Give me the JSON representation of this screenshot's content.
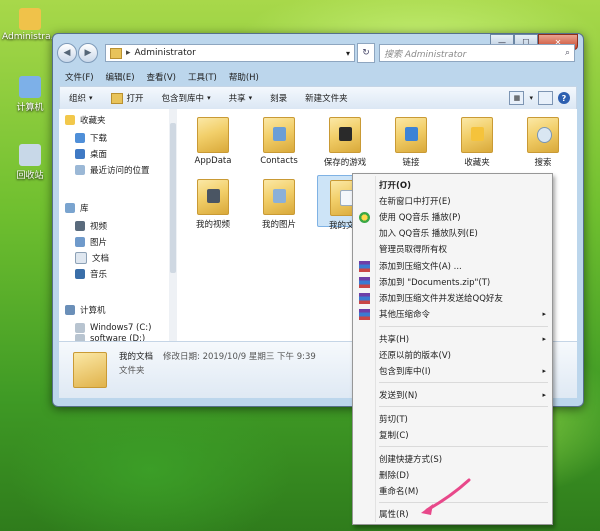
{
  "desktop": {
    "icons": [
      {
        "label": "Administra...",
        "color": "#f0c24a"
      },
      {
        "label": "计算机",
        "color": "#7db0e8"
      },
      {
        "label": "回收站",
        "color": "#c8d8e8"
      }
    ]
  },
  "window": {
    "controls": {
      "minimize": "—",
      "maximize": "☐",
      "close": "✕"
    },
    "nav": {
      "back": "◀",
      "forward": "▶"
    },
    "address": {
      "separator": "▸",
      "path": "Administrator",
      "dropdown": "▾"
    },
    "refresh": "↻",
    "search": {
      "placeholder": "搜索 Administrator",
      "icon": "⌕"
    },
    "menu": [
      "文件(F)",
      "编辑(E)",
      "查看(V)",
      "工具(T)",
      "帮助(H)"
    ],
    "toolbar": {
      "organize": "组织",
      "open": "打开",
      "include_library": "包含到库中",
      "share": "共享",
      "burn": "刻录",
      "new_folder": "新建文件夹",
      "chevron": "▾"
    },
    "nav_pane": {
      "favorites": "收藏夹",
      "favorite_items": [
        "下载",
        "桌面",
        "最近访问的位置"
      ],
      "libraries": "库",
      "library_items": [
        "视频",
        "图片",
        "文档",
        "音乐"
      ],
      "computer": "计算机",
      "drives": [
        "Windows7 (C:)",
        "software (D:)"
      ]
    },
    "files": [
      "AppData",
      "Contacts",
      "保存的游戏",
      "链接",
      "收藏夹",
      "搜索",
      "我的视频",
      "我的图片",
      "我的文档"
    ],
    "details": {
      "name": "我的文档",
      "modified": "修改日期: 2019/10/9 星期三 下午 9:39",
      "type": "文件夹"
    }
  },
  "context_menu": {
    "items": [
      {
        "label": "打开(O)",
        "bold": true,
        "submenu": false
      },
      {
        "label": "在新窗口中打开(E)",
        "submenu": false
      },
      {
        "label": "使用 QQ音乐 播放(P)",
        "icon": "qq",
        "submenu": false
      },
      {
        "label": "加入 QQ音乐 播放队列(E)",
        "submenu": false
      },
      {
        "label": "管理员取得所有权",
        "submenu": false
      },
      {
        "label": "添加到压缩文件(A) ...",
        "icon": "rar",
        "submenu": false
      },
      {
        "label": "添加到 \"Documents.zip\"(T)",
        "icon": "rar",
        "submenu": false
      },
      {
        "label": "添加到压缩文件并发送给QQ好友",
        "icon": "rar",
        "submenu": false
      },
      {
        "label": "其他压缩命令",
        "icon": "rar",
        "submenu": true
      },
      {
        "label": "共享(H)",
        "submenu": true
      },
      {
        "label": "还原以前的版本(V)",
        "submenu": false
      },
      {
        "label": "包含到库中(I)",
        "submenu": true
      },
      {
        "label": "发送到(N)",
        "submenu": true
      },
      {
        "label": "剪切(T)",
        "submenu": false
      },
      {
        "label": "复制(C)",
        "submenu": false
      },
      {
        "label": "创建快捷方式(S)",
        "submenu": false
      },
      {
        "label": "删除(D)",
        "submenu": false
      },
      {
        "label": "重命名(M)",
        "submenu": false
      },
      {
        "label": "属性(R)",
        "submenu": false
      }
    ],
    "submenu_arrow": "▸",
    "annotation_color": "#e8488a"
  }
}
